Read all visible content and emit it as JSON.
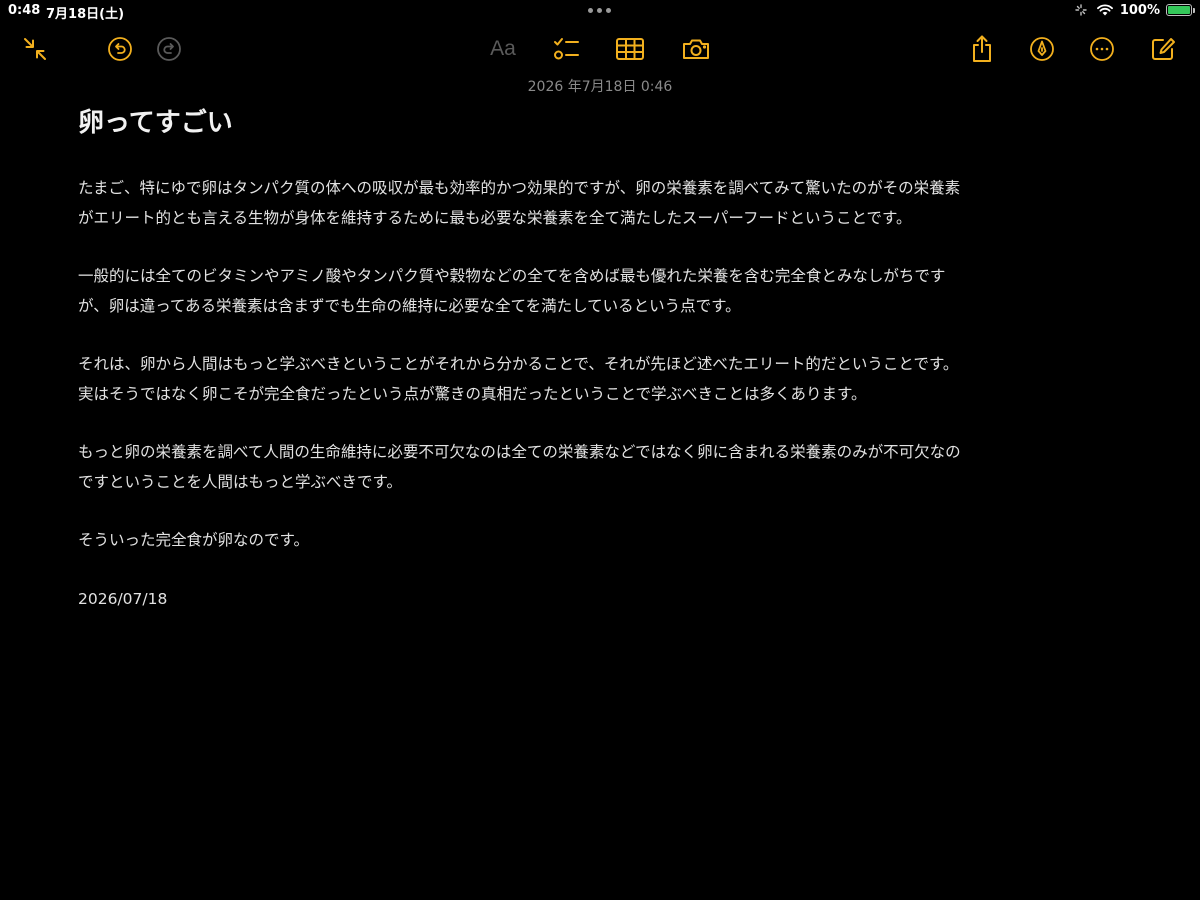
{
  "status_bar": {
    "time": "0:48",
    "date": "7月18日(土)",
    "battery_percent": "100%",
    "battery_level": 1.0,
    "battery_color": "#34c759"
  },
  "toolbar": {
    "accent_color": "#f2b01e",
    "collapse_icon": "arrows-in-icon",
    "undo_icon": "undo-icon",
    "redo_icon": "redo-icon",
    "format_label": "Aa",
    "checklist_icon": "checklist-icon",
    "table_icon": "table-icon",
    "camera_icon": "camera-icon",
    "share_icon": "share-icon",
    "markup_icon": "pen-icon",
    "more_icon": "more-icon",
    "compose_icon": "compose-icon"
  },
  "note": {
    "date": "2026 年7月18日 0:46",
    "title": "卵ってすごい",
    "paragraphs": [
      "たまご、特にゆで卵はタンパク質の体への吸収が最も効率的かつ効果的ですが、卵の栄養素を調べてみて驚いたのがその栄養素がエリート的とも言える生物が身体を維持するために最も必要な栄養素を全て満たしたスーパーフードということです。",
      "一般的には全てのビタミンやアミノ酸やタンパク質や穀物などの全てを含めば最も優れた栄養を含む完全食とみなしがちですが、卵は違ってある栄養素は含まずでも生命の維持に必要な全てを満たしているという点です。",
      "それは、卵から人間はもっと学ぶべきということがそれから分かることで、それが先ほど述べたエリート的だということです。実はそうではなく卵こそが完全食だったという点が驚きの真相だったということで学ぶべきことは多くあります。",
      "もっと卵の栄養素を調べて人間の生命維持に必要不可欠なのは全ての栄養素などではなく卵に含まれる栄養素のみが不可欠なのですということを人間はもっと学ぶべきです。",
      "そういった完全食が卵なのです。",
      "2026/07/18"
    ]
  }
}
